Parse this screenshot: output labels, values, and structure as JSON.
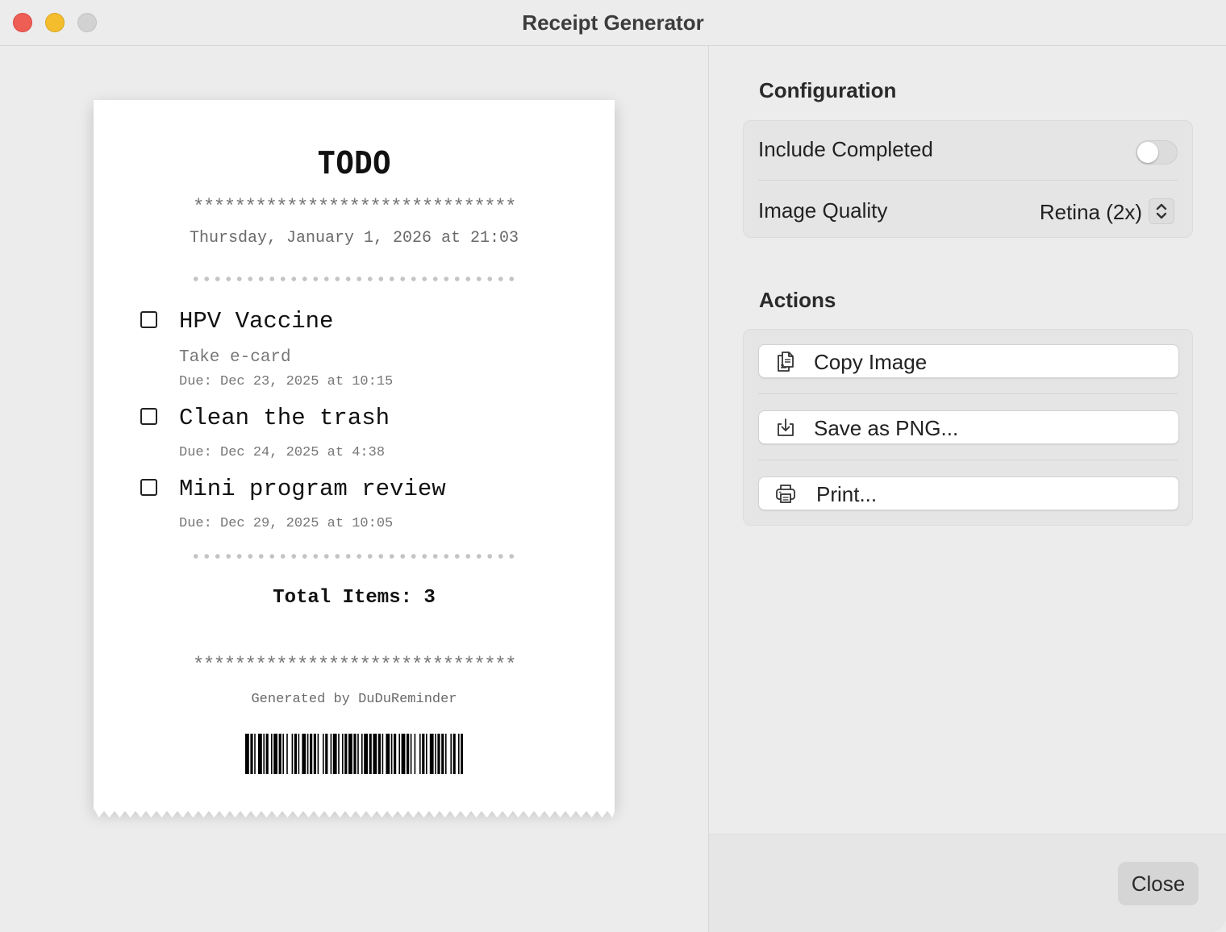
{
  "window": {
    "title": "Receipt Generator"
  },
  "receipt": {
    "title": "TODO",
    "stars": "*******************************",
    "date": "Thursday, January 1, 2026 at 21:03",
    "items": [
      {
        "title": "HPV Vaccine",
        "note": "Take e-card",
        "due": "Due: Dec 23, 2025 at 10:15",
        "checked": false
      },
      {
        "title": "Clean the trash",
        "due": "Due: Dec 24, 2025 at 4:38",
        "checked": false
      },
      {
        "title": "Mini program review",
        "due": "Due: Dec 29, 2025 at 10:05",
        "checked": false
      }
    ],
    "total": "Total Items: 3",
    "generated_by": "Generated by DuDuReminder"
  },
  "config": {
    "section_title": "Configuration",
    "include_completed_label": "Include Completed",
    "include_completed": false,
    "image_quality_label": "Image Quality",
    "image_quality_value": "Retina (2x)"
  },
  "actions": {
    "section_title": "Actions",
    "copy_label": "Copy Image",
    "save_label": "Save as PNG...",
    "print_label": "Print..."
  },
  "footer": {
    "close_label": "Close"
  },
  "colors": {
    "close": "#ee5e55",
    "minimize": "#f4bd2e",
    "zoom": "#d2d2d2"
  }
}
